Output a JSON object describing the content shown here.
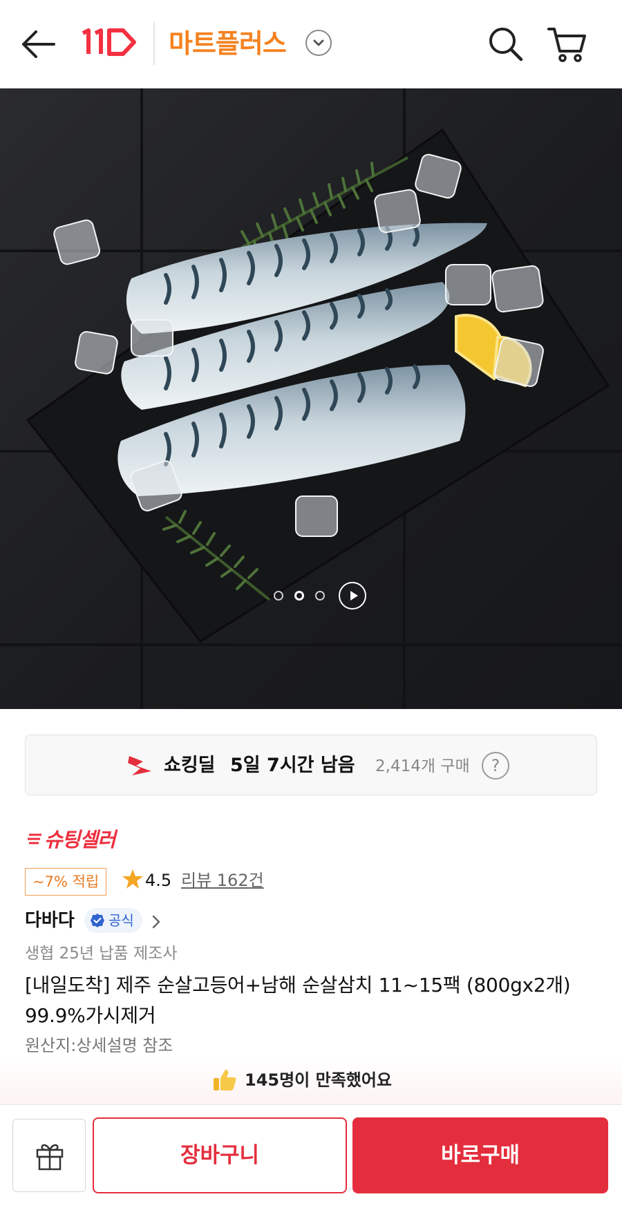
{
  "header": {
    "logo_icon": "11st-logo",
    "mall_name": "마트플러스",
    "icons": [
      "back-arrow-icon",
      "chevron-down-icon",
      "search-icon",
      "cart-icon"
    ],
    "accent_color": "#f58220"
  },
  "gallery": {
    "image_description_icon": "mackerel-fillets-photo",
    "total_slides": 3,
    "active_slide": 2
  },
  "deal": {
    "label": "쇼킹딜",
    "remaining": "5일 7시간 남음",
    "purchase_count": "2,414개 구매",
    "help": "?"
  },
  "product": {
    "seller_badge": "슈팅셀러",
    "points": "~7% 적립",
    "rating": "4.5",
    "reviews": "리뷰 162건",
    "brand": "다바다",
    "official_label": "공식",
    "subtitle": "생협 25년 납품 제조사",
    "title": "[내일도착] 제주 순살고등어+남해 순살삼치 11~15팩 (800gx2개) 99.9%가시제거",
    "origin": "원산지:상세설명 참조"
  },
  "satisfaction": {
    "text": "145명이 만족했어요"
  },
  "bottom": {
    "cart_label": "장바구니",
    "buy_label": "바로구매",
    "brand_color": "#e42e3d"
  }
}
